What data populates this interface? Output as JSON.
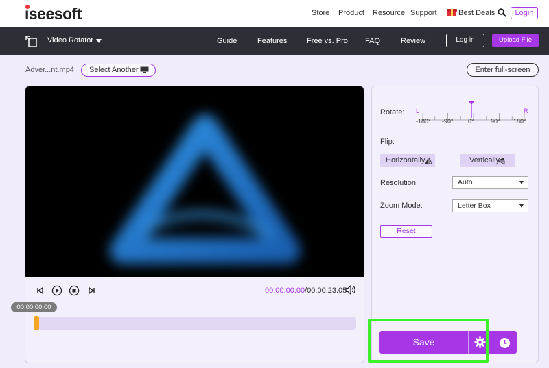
{
  "brand": {
    "logo_text": "aiseesoft"
  },
  "topnav": {
    "links": [
      "Store",
      "Product",
      "Resource",
      "Support"
    ],
    "best_deals": "Best Deals",
    "login": "Login"
  },
  "toolbar": {
    "tool_name": "Video Rotator",
    "links": [
      "Guide",
      "Features",
      "Free vs. Pro",
      "FAQ",
      "Review"
    ],
    "login": "Log in",
    "upload": "Upload File"
  },
  "file": {
    "name": "Adver...nt.mp4",
    "select_another": "Select Another",
    "fullscreen": "Enter full-screen"
  },
  "player": {
    "current_time": "00:00:00.00",
    "separator": "/",
    "total_time": "00:00:23.05",
    "bubble_time": "00:00:00.00",
    "progress": 0.0
  },
  "settings": {
    "rotate_label": "Rotate:",
    "rotate_left": "L",
    "rotate_right": "R",
    "rotate_ticks": [
      "-180°",
      "-90°",
      "0°",
      "90°",
      "180°"
    ],
    "rotate_value_deg": 0,
    "flip_label": "Flip:",
    "flip_horizontal": "Horizontally",
    "flip_vertical": "Vertically",
    "resolution_label": "Resolution:",
    "resolution_value": "Auto",
    "zoom_label": "Zoom Mode:",
    "zoom_value": "Letter Box",
    "reset": "Reset",
    "save": "Save"
  },
  "colors": {
    "accent": "#a737e6",
    "dark_bar": "#2e2e36",
    "highlight": "#3cf02a",
    "handle": "#f5a623"
  }
}
